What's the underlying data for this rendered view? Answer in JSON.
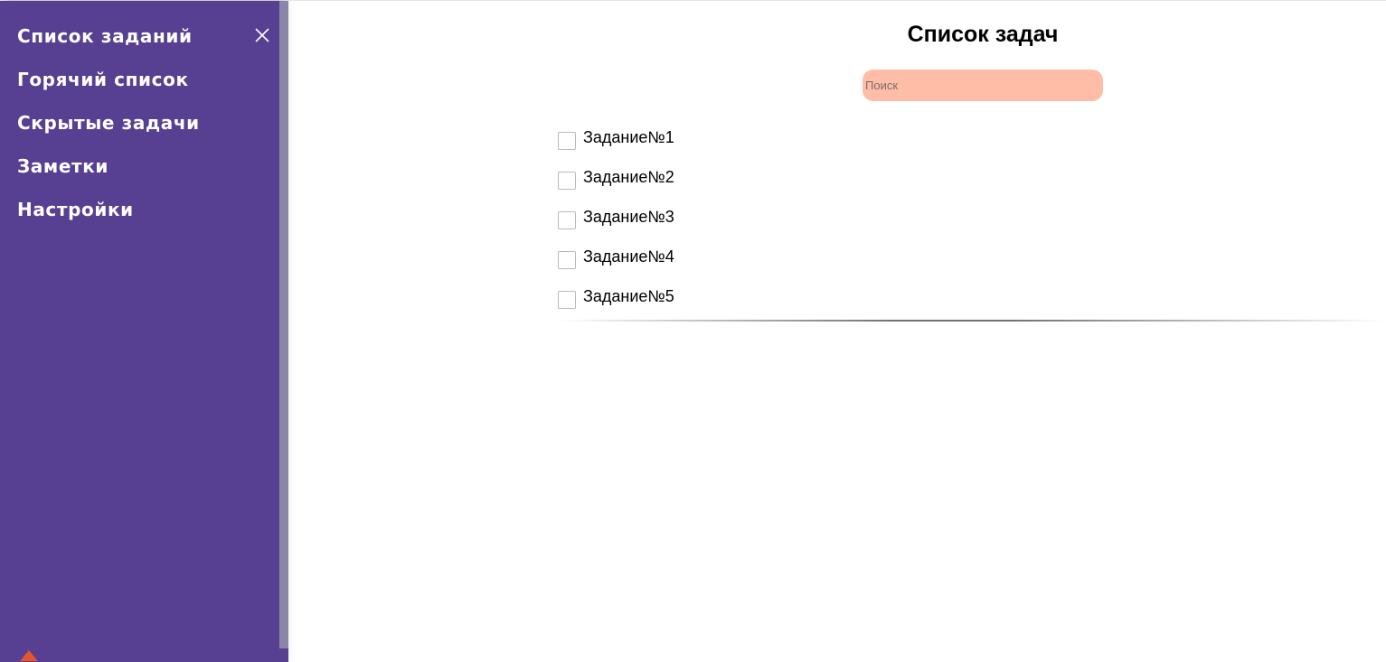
{
  "sidebar": {
    "items": [
      {
        "label": "Список заданий"
      },
      {
        "label": "Горячий список"
      },
      {
        "label": "Скрытые задачи"
      },
      {
        "label": "Заметки"
      },
      {
        "label": "Настройки"
      }
    ],
    "close_icon": "close-icon",
    "scroll_up_icon": "caret-up-icon",
    "background_color": "#573f92",
    "accent_color": "#e8552a"
  },
  "main": {
    "title": "Список задач",
    "search": {
      "placeholder": "Поиск",
      "value": "",
      "background_color": "#ffbca6"
    },
    "tasks": [
      {
        "label": "Задание№1",
        "checked": false
      },
      {
        "label": "Задание№2",
        "checked": false
      },
      {
        "label": "Задание№3",
        "checked": false
      },
      {
        "label": "Задание№4",
        "checked": false
      },
      {
        "label": "Задание№5",
        "checked": false
      }
    ]
  }
}
